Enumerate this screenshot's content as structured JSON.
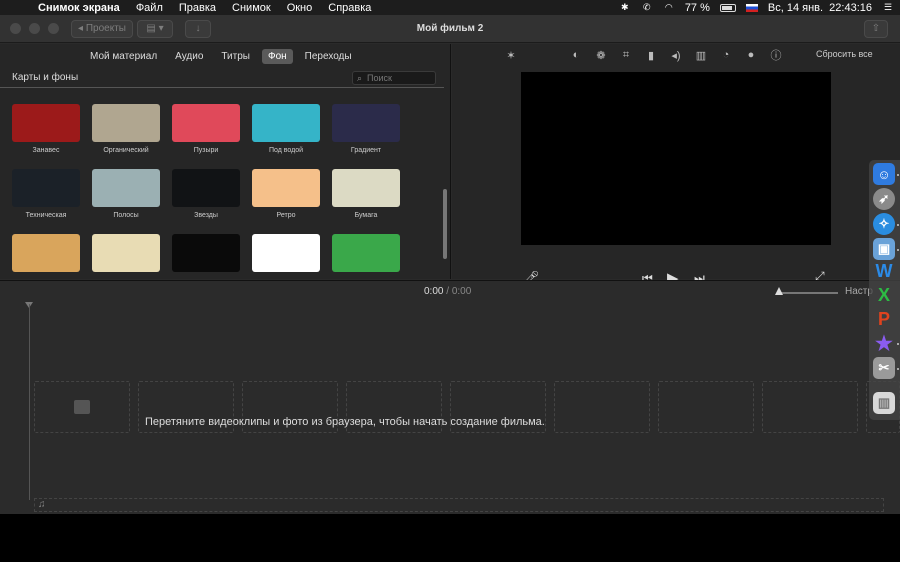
{
  "menubar": {
    "app_name": "Снимок экрана",
    "items": [
      "Файл",
      "Правка",
      "Снимок",
      "Окно",
      "Справка"
    ],
    "battery": "77 %",
    "datetime": "Вс, 14 янв.  22:43:16"
  },
  "titlebar": {
    "back_label": "◂ Проекты",
    "title": "Мой фильм 2"
  },
  "browser": {
    "tabs": [
      "Мой материал",
      "Аудио",
      "Титры",
      "Фон",
      "Переходы"
    ],
    "active_tab": "Фон",
    "section_title": "Карты и фоны",
    "search_placeholder": "Поиск",
    "backgrounds": [
      {
        "label": "Занавес",
        "color": "#9c1a1a"
      },
      {
        "label": "Органический",
        "color": "#b0a690"
      },
      {
        "label": "Пузыри",
        "color": "#e0495a"
      },
      {
        "label": "Под водой",
        "color": "#35b4c8"
      },
      {
        "label": "Градиент",
        "color": "#2b2b4a"
      },
      {
        "label": "Техническая",
        "color": "#1b2128"
      },
      {
        "label": "Полосы",
        "color": "#9bb0b3"
      },
      {
        "label": "Звезды",
        "color": "#111315"
      },
      {
        "label": "Ретро",
        "color": "#f5c08a"
      },
      {
        "label": "Бумага",
        "color": "#dcdac4"
      },
      {
        "label": "",
        "color": "#d9a55c"
      },
      {
        "label": "",
        "color": "#e8dcb4"
      },
      {
        "label": "",
        "color": "#0a0a0a"
      },
      {
        "label": "",
        "color": "#ffffff"
      },
      {
        "label": "",
        "color": "#3aa84a"
      }
    ]
  },
  "viewer": {
    "reset_all": "Сбросить все"
  },
  "timeline": {
    "current_time": "0:00",
    "separator": "/",
    "total_time": "0:00",
    "settings_label": "Настр",
    "drop_hint": "Перетяните видеоклипы и фото из браузера, чтобы начать создание фильма."
  },
  "dock": {
    "apps": [
      "finder-icon",
      "launchpad-icon",
      "safari-icon",
      "preview-icon",
      "word-icon",
      "excel-icon",
      "powerpoint-icon",
      "imovie-icon",
      "screenshot-icon",
      "trash-icon"
    ]
  }
}
